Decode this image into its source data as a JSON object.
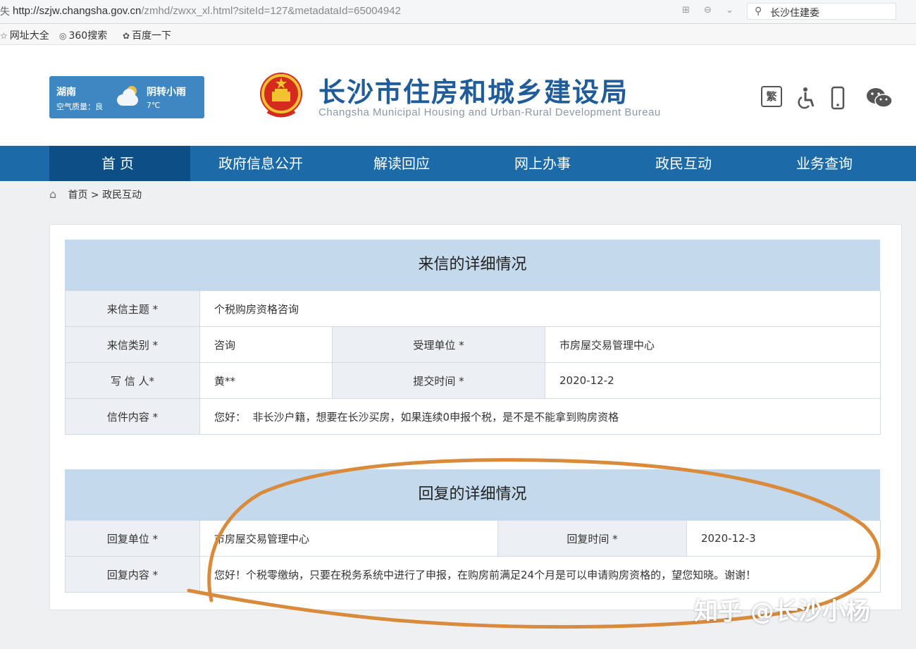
{
  "browser": {
    "addr_prefix": "失",
    "url_host": "http://szjw.changsha.gov.cn",
    "url_path": "/zmhd/zwxx_xl.html?siteId=127&metadataId=65004942",
    "search_text": "长沙住建委",
    "bookmarks": [
      "网址大全",
      "360搜索",
      "百度一下"
    ]
  },
  "weather": {
    "city": "湖南",
    "air_quality": "空气质量：良",
    "condition": "阴转小雨",
    "temp": "7℃"
  },
  "site": {
    "title_zh": "长沙市住房和城乡建设局",
    "title_en": "Changsha Municipal Housing and Urban-Rural Development Bureau",
    "traditional_label": "繁"
  },
  "nav": [
    "首页",
    "政府信息公开",
    "解读回应",
    "网上办事",
    "政民互动",
    "业务查询"
  ],
  "breadcrumb": {
    "home": "首页",
    "sep": ">",
    "current": "政民互动"
  },
  "letter": {
    "heading": "来信的详细情况",
    "subject_label": "来信主题 *",
    "subject": "个税购房资格咨询",
    "category_label": "来信类别 *",
    "category": "咨询",
    "dept_label": "受理单位 *",
    "dept": "市房屋交易管理中心",
    "writer_label": "写 信 人*",
    "writer": "黄**",
    "submit_label": "提交时间 *",
    "submit_time": "2020-12-2",
    "content_label": "信件内容 *",
    "content": "您好：  非长沙户籍，想要在长沙买房，如果连续0申报个税，是不是不能拿到购房资格"
  },
  "reply": {
    "heading": "回复的详细情况",
    "unit_label": "回复单位 *",
    "unit": "市房屋交易管理中心",
    "time_label": "回复时间 *",
    "time": "2020-12-3",
    "content_label": "回复内容 *",
    "content": "您好！个税零缴纳，只要在税务系统中进行了申报，在购房前满足24个月是可以申请购房资格的，望您知晓。谢谢！"
  },
  "watermark": "知乎 @长沙小杨",
  "colors": {
    "nav_bg": "#1c6aa8",
    "nav_active": "#0d4e86",
    "title": "#1f5c99",
    "section_head": "#c4d9ec",
    "label_cell": "#eceff4",
    "annotation": "#d98a3a"
  }
}
